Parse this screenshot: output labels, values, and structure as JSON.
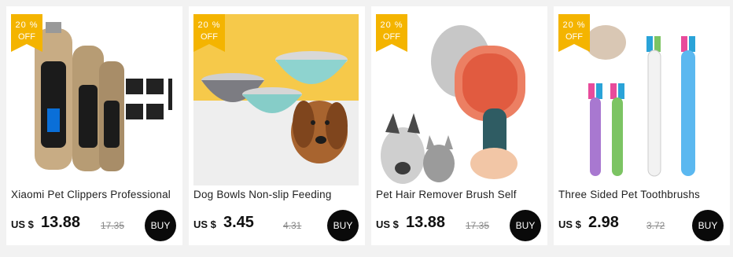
{
  "products": [
    {
      "badge_percent": "20 %",
      "badge_off": "OFF",
      "title": "Xiaomi Pet Clippers Professional",
      "currency": "US $",
      "price": "13.88",
      "original_price": "17.35",
      "buy_label": "BUY"
    },
    {
      "badge_percent": "20 %",
      "badge_off": "OFF",
      "title": "Dog Bowls Non-slip Feeding",
      "currency": "US $",
      "price": "3.45",
      "original_price": "4.31",
      "buy_label": "BUY"
    },
    {
      "badge_percent": "20 %",
      "badge_off": "OFF",
      "title": "Pet Hair Remover Brush Self",
      "currency": "US $",
      "price": "13.88",
      "original_price": "17.35",
      "buy_label": "BUY"
    },
    {
      "badge_percent": "20 %",
      "badge_off": "OFF",
      "title": "Three Sided Pet Toothbrushs",
      "currency": "US $",
      "price": "2.98",
      "original_price": "3.72",
      "buy_label": "BUY"
    }
  ],
  "colors": {
    "badge": "#f4b400",
    "buy_button": "#0a0a0a",
    "background": "#f2f2f2"
  }
}
